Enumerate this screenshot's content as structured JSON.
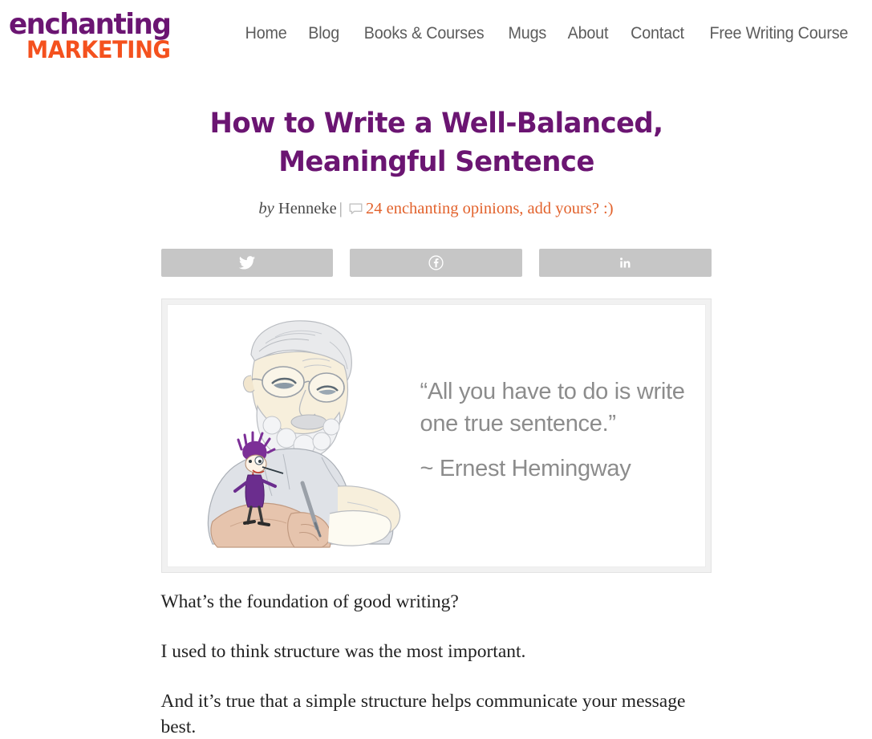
{
  "header": {
    "logo": {
      "line1": "enchanting",
      "line2": "MARKETING",
      "purple": "#6b1572",
      "orange": "#f4511e"
    },
    "nav": [
      {
        "label": "Home"
      },
      {
        "label": "Blog"
      },
      {
        "label": "Books & Courses"
      },
      {
        "label": "Mugs"
      },
      {
        "label": "About"
      },
      {
        "label": "Contact"
      },
      {
        "label": "Free Writing Course"
      }
    ]
  },
  "post": {
    "title": "How to Write a Well-Balanced, Meaningful Sentence",
    "title_color": "#6b1572",
    "byline": {
      "by_word": "by",
      "author": "Henneke",
      "separator": "|",
      "comments_link": "24 enchanting opinions, add yours? :)",
      "comment_count": "24",
      "link_color": "#e2622c",
      "comment_icon": "speech-bubble-icon"
    },
    "share": [
      {
        "network": "Twitter",
        "icon": "twitter-bird-icon"
      },
      {
        "network": "Facebook",
        "icon": "facebook-f-icon"
      },
      {
        "network": "LinkedIn",
        "icon": "linkedin-in-icon"
      }
    ],
    "featured_image": {
      "alt": "Cartoon illustration of Ernest Hemingway writing, with a small purple-haired character",
      "quote": "“All you have to do is write one true sentence.”",
      "attribution": "~ Ernest Hemingway",
      "quote_color": "#8c8c8c"
    },
    "paragraphs": [
      "What’s the foundation of good writing?",
      "I used to think structure was the most important.",
      "And it’s true that a simple structure helps communicate your message best."
    ]
  }
}
